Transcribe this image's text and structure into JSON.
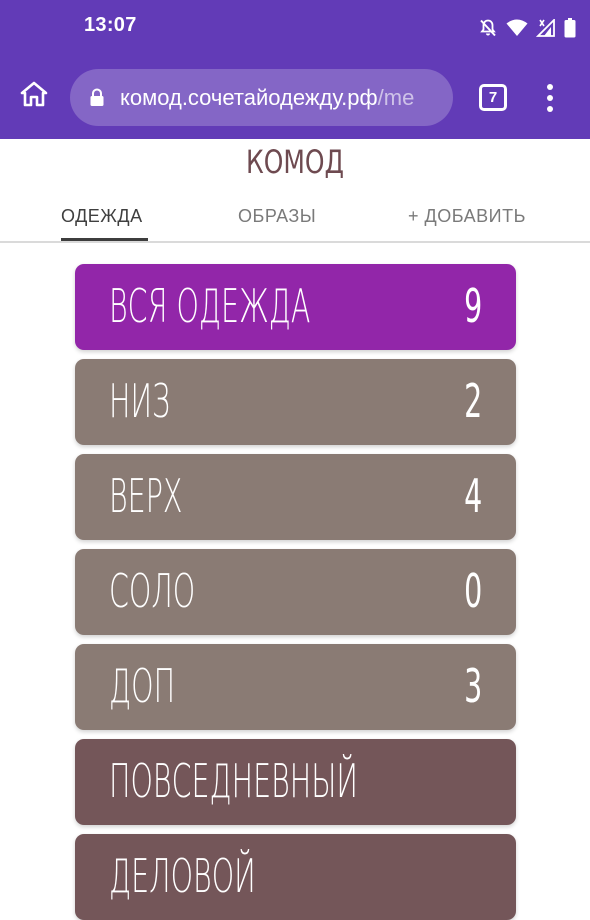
{
  "status_bar": {
    "time": "13:07",
    "icons": [
      "bell-off-icon",
      "wifi-icon",
      "signal-icon",
      "battery-icon"
    ]
  },
  "browser": {
    "url_domain": "комод.сочетайодежду.рф",
    "url_path": "/me",
    "tab_count": "7",
    "theme_color": "#623bb7"
  },
  "app": {
    "title": "КОМОД"
  },
  "tabs": [
    {
      "label": "ОДЕЖДА",
      "active": true
    },
    {
      "label": "ОБРАЗЫ",
      "active": false
    },
    {
      "label": "+ ДОБАВИТЬ",
      "active": false
    }
  ],
  "categories": [
    {
      "label": "ВСЯ ОДЕЖДА",
      "count": "9",
      "color": "#9226a9"
    },
    {
      "label": "НИЗ",
      "count": "2",
      "color": "#8a7b74"
    },
    {
      "label": "ВЕРХ",
      "count": "4",
      "color": "#8a7b74"
    },
    {
      "label": "СОЛО",
      "count": "0",
      "color": "#8a7b74"
    },
    {
      "label": "ДОП",
      "count": "3",
      "color": "#8a7b74"
    },
    {
      "label": "ПОВСЕДНЕВНЫЙ",
      "count": "",
      "color": "#745659"
    },
    {
      "label": "ДЕЛОВОЙ",
      "count": "",
      "color": "#745659"
    }
  ]
}
